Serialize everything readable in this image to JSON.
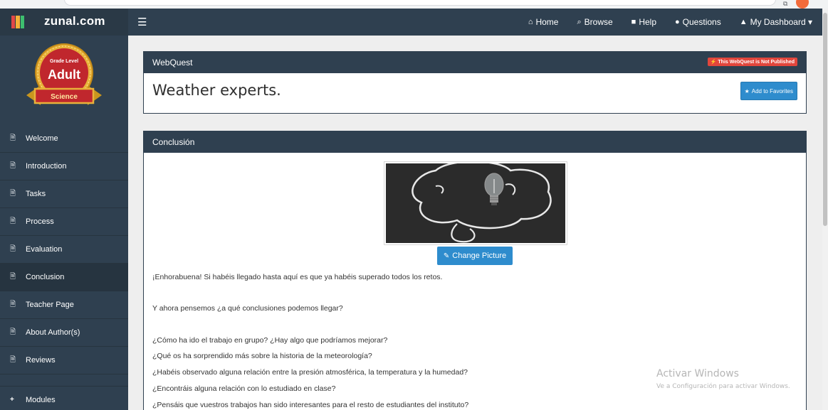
{
  "browser": {
    "address_text": ""
  },
  "navbar": {
    "brand": "zunal.com",
    "links": [
      {
        "icon": "home-icon",
        "glyph": "⌂",
        "label": "Home"
      },
      {
        "icon": "search-icon",
        "glyph": "⌕",
        "label": "Browse"
      },
      {
        "icon": "book-icon",
        "glyph": "■",
        "label": "Help"
      },
      {
        "icon": "comments-icon",
        "glyph": "●",
        "label": "Questions"
      },
      {
        "icon": "user-icon",
        "glyph": "▲",
        "label": "My Dashboard ▾"
      }
    ]
  },
  "badge": {
    "top": "Grade Level",
    "middle": "Adult",
    "bottom": "Science"
  },
  "sidebar": {
    "items": [
      {
        "label": "Welcome"
      },
      {
        "label": "Introduction"
      },
      {
        "label": "Tasks"
      },
      {
        "label": "Process"
      },
      {
        "label": "Evaluation"
      },
      {
        "label": "Conclusion"
      },
      {
        "label": "Teacher Page"
      },
      {
        "label": "About Author(s)"
      },
      {
        "label": "Reviews"
      }
    ],
    "modules_label": "Modules"
  },
  "webquest": {
    "header": "WebQuest",
    "status_badge": "This WebQuest is Not Published",
    "title": "Weather experts.",
    "favorites_label": "Add to Favorites"
  },
  "conclusion": {
    "header": "Conclusión",
    "change_picture_label": "Change Picture",
    "paragraphs": [
      "¡Enhorabuena! Si habéis llegado hasta aquí es que ya habéis superado todos los retos.",
      "Y ahora pensemos ¿a qué conclusiones podemos llegar?",
      "¿Cómo ha ido el trabajo en grupo? ¿Hay algo que podríamos mejorar?",
      "¿Qué os ha sorprendido más sobre la historia de la meteorología?",
      "¿Habéis observado alguna relación entre la presión atmosférica, la temperatura y la humedad?",
      "¿Encontráis alguna relación con lo estudiado en clase?",
      "¿Pensáis que vuestros trabajos han sido interesantes para el resto de estudiantes del instituto?"
    ]
  },
  "watermark": {
    "title": "Activar Windows",
    "subtitle": "Ve a Configuración para activar Windows."
  },
  "colors": {
    "navbar": "#2f4050",
    "accent_button": "#2e8ccd",
    "badge_red": "#e2463c",
    "brand_logo": [
      "#e24848",
      "#f6b13a",
      "#3dbf6f"
    ]
  }
}
